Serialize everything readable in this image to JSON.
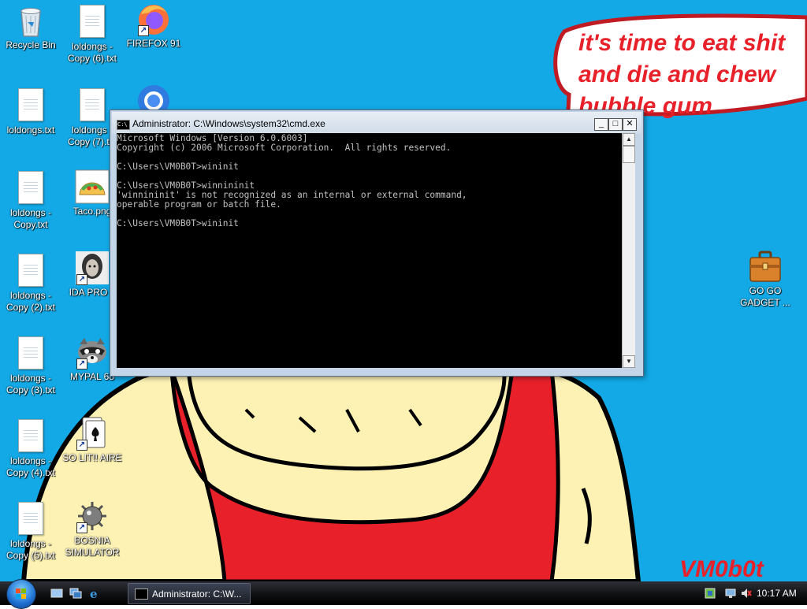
{
  "wallpaper": {
    "speech_lines": [
      "it's time to eat shit",
      "and die and chew",
      "bubble gum"
    ],
    "signature": "VM0b0t",
    "speech_color": "#e8202a",
    "background_color": "#12a9e6"
  },
  "desktop_icons": [
    {
      "label": "Recycle Bin",
      "icon": "recycle-bin-icon"
    },
    {
      "label": "loldongs - Copy (6).txt",
      "icon": "text-file-icon"
    },
    {
      "label": "FIREFOX 91",
      "icon": "firefox-icon"
    },
    {
      "label": "loldongs.txt",
      "icon": "text-file-icon"
    },
    {
      "label": "loldongs - Copy (7).txt",
      "icon": "text-file-icon"
    },
    {
      "label": "",
      "icon": "chrome-icon"
    },
    {
      "label": "loldongs - Copy.txt",
      "icon": "text-file-icon"
    },
    {
      "label": "Taco.png",
      "icon": "taco-image-icon"
    },
    {
      "label": "loldongs - Copy (2).txt",
      "icon": "text-file-icon"
    },
    {
      "label": "IDA PRO 6",
      "icon": "ida-pro-icon"
    },
    {
      "label": "loldongs - Copy (3).txt",
      "icon": "text-file-icon"
    },
    {
      "label": "MYPAL 68",
      "icon": "raccoon-icon"
    },
    {
      "label": "loldongs - Copy (4).txt",
      "icon": "text-file-icon"
    },
    {
      "label": "SO LIT!! AIRE",
      "icon": "solitaire-icon"
    },
    {
      "label": "loldongs - Copy (5).txt",
      "icon": "text-file-icon"
    },
    {
      "label": "BOSNIA SIMULATOR",
      "icon": "minesweeper-icon"
    },
    {
      "label": "GO GO GADGET ...",
      "icon": "briefcase-icon"
    }
  ],
  "cmd_window": {
    "title": "Administrator: C:\\Windows\\system32\\cmd.exe",
    "app_icon_text": "C:\\",
    "minimize": "_",
    "maximize": "□",
    "close": "✕",
    "output": "Microsoft Windows [Version 6.0.6003]\nCopyright (c) 2006 Microsoft Corporation.  All rights reserved.\n\nC:\\Users\\VM0B0T>wininit\n\nC:\\Users\\VM0B0T>winnininit\n'winnininit' is not recognized as an internal or external command,\noperable program or batch file.\n\nC:\\Users\\VM0B0T>wininit",
    "scroll_up": "▲",
    "scroll_down": "▼"
  },
  "taskbar": {
    "task_button_label": "Administrator: C:\\W...",
    "clock": "10:17 AM"
  }
}
